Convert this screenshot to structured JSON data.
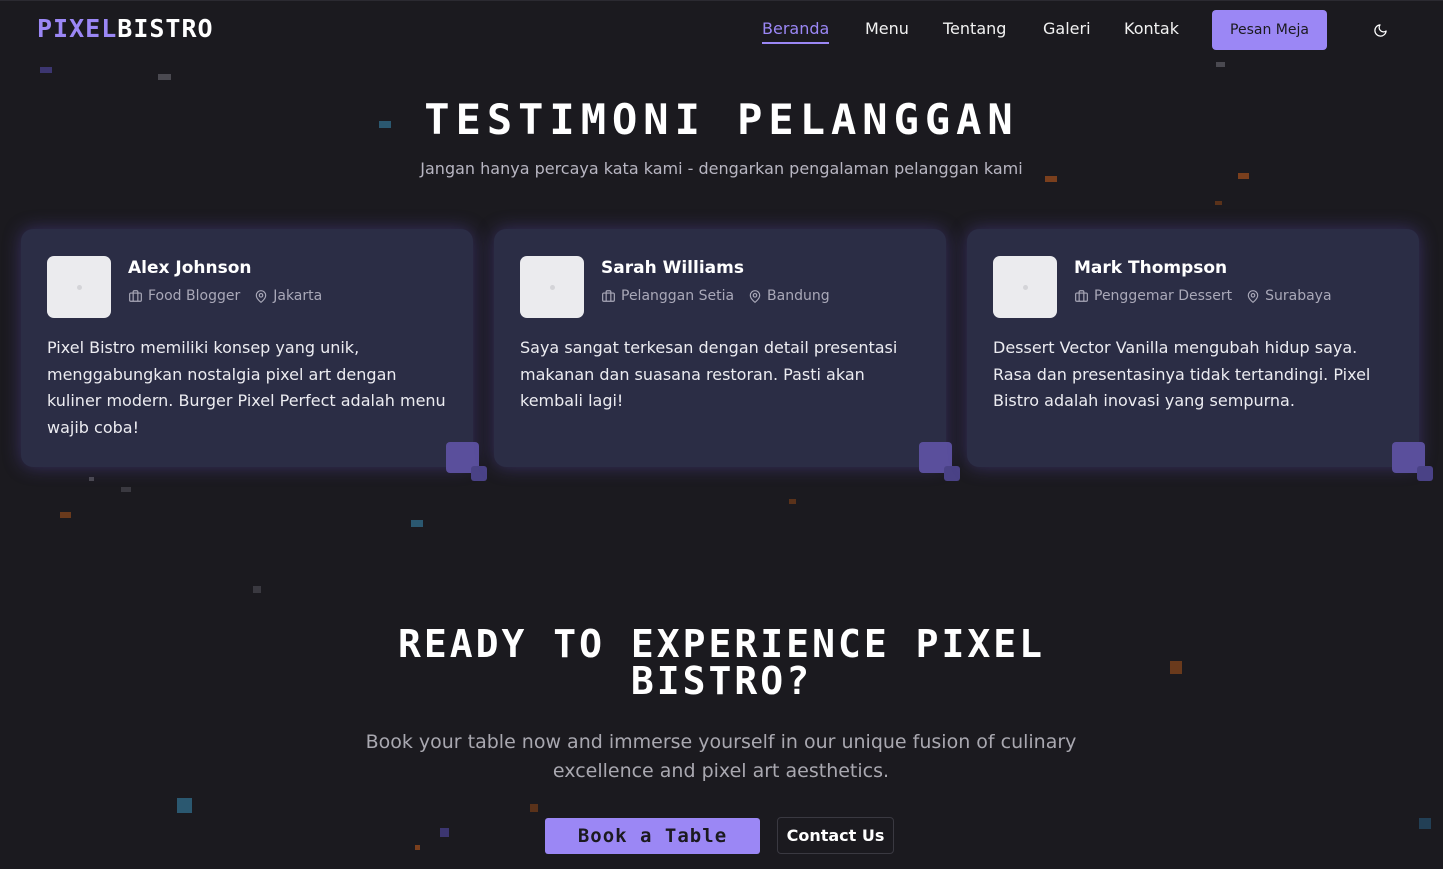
{
  "brand": {
    "part1": "PIXEL",
    "part2": "BISTRO"
  },
  "nav": {
    "links": [
      {
        "label": "Beranda",
        "active": true
      },
      {
        "label": "Menu"
      },
      {
        "label": "Tentang"
      },
      {
        "label": "Galeri"
      },
      {
        "label": "Kontak"
      }
    ],
    "cta_label": "Pesan Meja",
    "theme_icon": "moon-icon"
  },
  "testimonials": {
    "title": "TESTIMONI PELANGGAN",
    "subtitle": "Jangan hanya percaya kata kami - dengarkan pengalaman pelanggan kami",
    "cards": [
      {
        "name": "Alex Johnson",
        "role": "Food Blogger",
        "location": "Jakarta",
        "quote": "Pixel Bistro memiliki konsep yang unik, menggabungkan nostalgia pixel art dengan kuliner modern. Burger Pixel Perfect adalah menu wajib coba!"
      },
      {
        "name": "Sarah Williams",
        "role": "Pelanggan Setia",
        "location": "Bandung",
        "quote": "Saya sangat terkesan dengan detail presentasi makanan dan suasana restoran. Pasti akan kembali lagi!"
      },
      {
        "name": "Mark Thompson",
        "role": "Penggemar Dessert",
        "location": "Surabaya",
        "quote": "Dessert Vector Vanilla mengubah hidup saya. Rasa dan presentasinya tidak tertandingi. Pixel Bistro adalah inovasi yang sempurna."
      }
    ]
  },
  "cta": {
    "title": "READY TO EXPERIENCE PIXEL BISTRO?",
    "text": "Book your table now and immerse yourself in our unique fusion of culinary excellence and pixel art aesthetics.",
    "book_label": "Book a Table",
    "contact_label": "Contact Us"
  },
  "colors": {
    "background": "#1b1a1f",
    "accent": "#9b87f5",
    "card": "#2b2d45"
  }
}
